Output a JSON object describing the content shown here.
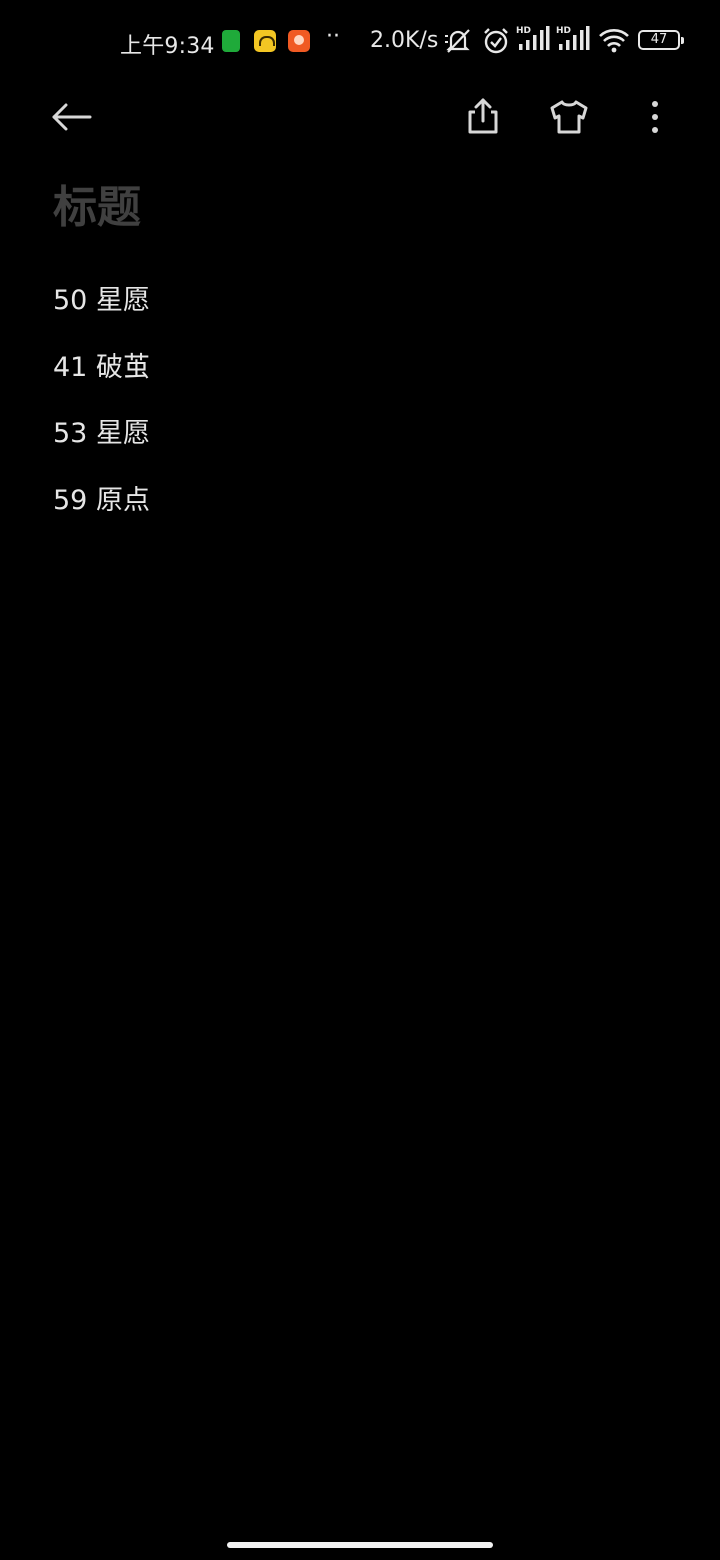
{
  "status_bar": {
    "time": "上午9:34",
    "app_icons": [
      "battery-saver-app-icon",
      "yellow-app-icon",
      "orange-app-icon"
    ],
    "more_indicator": "··",
    "network_speed": "2.0K/s",
    "icons": [
      "mute-icon",
      "alarm-icon",
      "signal-hd-1-icon",
      "signal-hd-2-icon",
      "wifi-icon"
    ],
    "battery": "47"
  },
  "toolbar": {
    "back_icon": "arrow-left-icon",
    "share_icon": "share-icon",
    "theme_icon": "tshirt-icon",
    "more_icon": "more-vertical-icon"
  },
  "note": {
    "title_placeholder": "标题",
    "lines": [
      "50 星愿",
      "41 破茧",
      "53 星愿",
      "59 原点"
    ]
  },
  "colors": {
    "background": "#000000",
    "text": "#e6e6e6",
    "title_placeholder": "#404040"
  }
}
